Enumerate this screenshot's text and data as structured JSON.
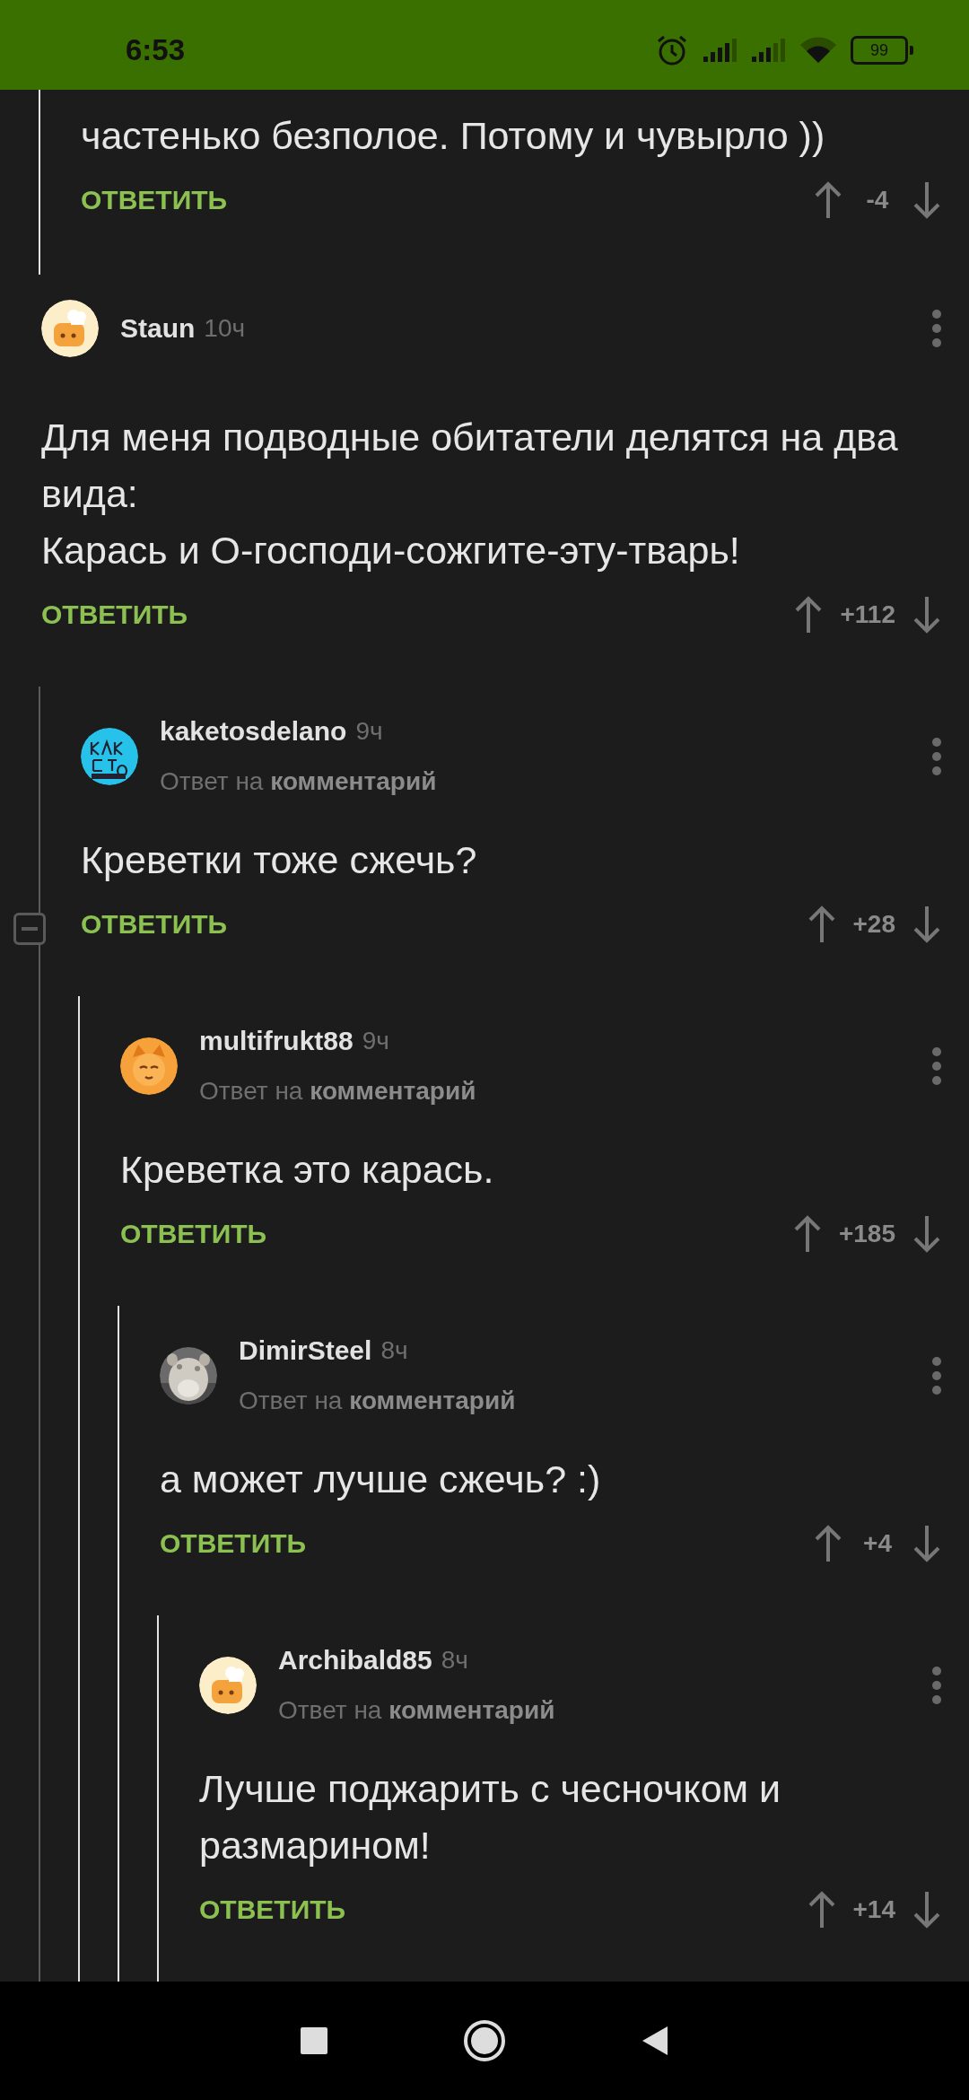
{
  "status_bar": {
    "time": "6:53",
    "battery": "99"
  },
  "previous_reply": {
    "text": "частенько безполое. Потому и чувырло ))",
    "reply_label": "ОТВЕТИТЬ",
    "score": "-4"
  },
  "comments": [
    {
      "author": "Staun",
      "time": "10ч",
      "avatar": {
        "kind": "chef"
      },
      "text": "Для меня подводные обитатели делятся на два вида:\nКарась и О-господи-сожгите-эту-тварь!",
      "reply_label": "ОТВЕТИТЬ",
      "score": "+112",
      "children": [
        {
          "author": "kaketosdelano",
          "time": "9ч",
          "avatar": {
            "kind": "logo"
          },
          "reply_to": "Ответ на **комментарий**",
          "text": "Креветки тоже сжечь?",
          "reply_label": "ОТВЕТИТЬ",
          "score": "+28",
          "collapse_toggle": {
            "expanded": true
          },
          "children": [
            {
              "author": "multifrukt88",
              "time": "9ч",
              "avatar": {
                "kind": "cat"
              },
              "reply_to": "Ответ на **комментарий**",
              "text": "Креветка это карась.",
              "reply_label": "ОТВЕТИТЬ",
              "score": "+185",
              "children": [
                {
                  "author": "DimirSteel",
                  "time": "8ч",
                  "reply_to": "Ответ на **комментарий**",
                  "text": "а может лучше сжечь? :)",
                  "reply_label": "ОТВЕТИТЬ",
                  "score": "+4",
                  "children": [
                    {
                      "author": "Archibald85",
                      "time": "8ч",
                      "avatar": {
                        "kind": "chef"
                      },
                      "reply_to": "Ответ на **комментарий**",
                      "text": "Лучше поджарить с чесночком и размарином!",
                      "reply_label": "ОТВЕТИТЬ",
                      "score": "+14"
                    }
                  ]
                }
              ]
            }
          ]
        }
      ]
    }
  ]
}
